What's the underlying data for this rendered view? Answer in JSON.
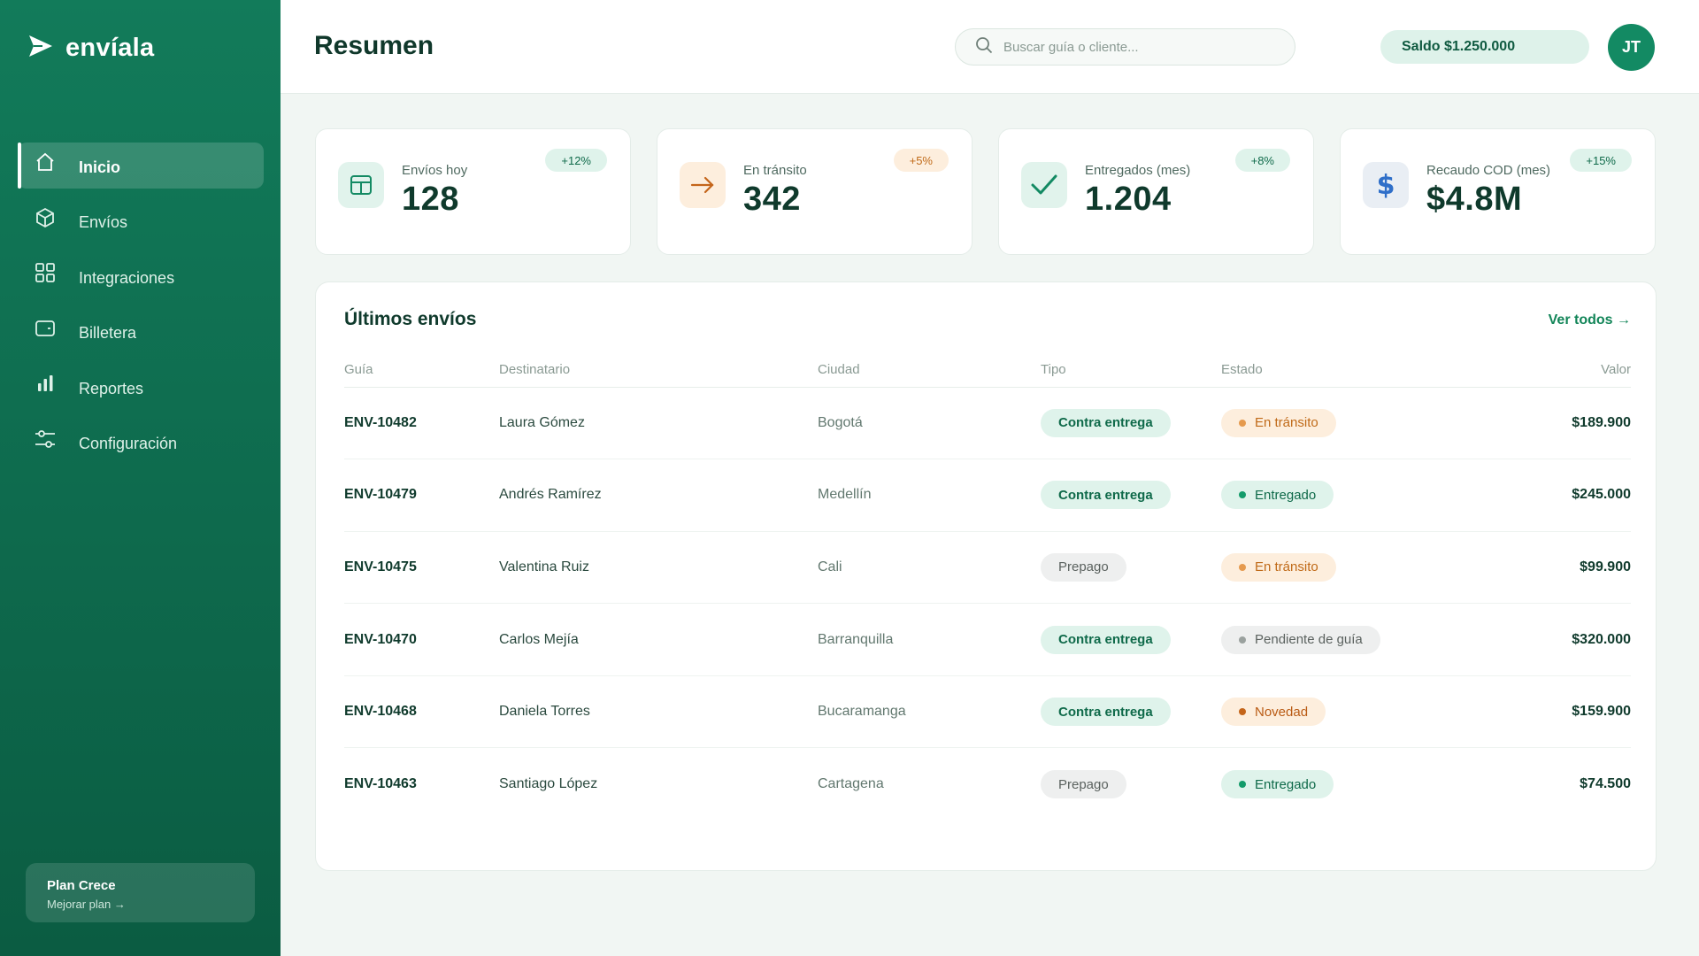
{
  "brand": {
    "name": "envíala"
  },
  "sidebar": {
    "items": [
      {
        "label": "Inicio",
        "icon": "home-icon",
        "active": true
      },
      {
        "label": "Envíos",
        "icon": "box-icon",
        "active": false
      },
      {
        "label": "Integraciones",
        "icon": "grid-icon",
        "active": false
      },
      {
        "label": "Billetera",
        "icon": "wallet-icon",
        "active": false
      },
      {
        "label": "Reportes",
        "icon": "bar-chart-icon",
        "active": false
      },
      {
        "label": "Configuración",
        "icon": "sliders-icon",
        "active": false
      }
    ],
    "plan": {
      "title": "Plan Crece",
      "link": "Mejorar plan →"
    }
  },
  "header": {
    "title": "Resumen",
    "search": {
      "placeholder": "Buscar guía o cliente...",
      "value": ""
    },
    "balance": "Saldo $1.250.000",
    "avatar": "JT"
  },
  "stats": [
    {
      "label": "Envíos hoy",
      "value": "128",
      "delta": "+12%",
      "icon": "table-icon",
      "icon_color": "#138a63",
      "icon_bg": "#e1f3ec",
      "delta_bg": "#dff3eb",
      "delta_color": "#0f6a4a"
    },
    {
      "label": "En tránsito",
      "value": "342",
      "delta": "+5%",
      "icon": "arrow-right-icon",
      "icon_color": "#c4651a",
      "icon_bg": "#fdeedd",
      "delta_bg": "#fdeedd",
      "delta_color": "#c06a18"
    },
    {
      "label": "Entregados (mes)",
      "value": "1.204",
      "delta": "+8%",
      "icon": "check-icon",
      "icon_color": "#138a63",
      "icon_bg": "#e1f3ec",
      "delta_bg": "#dff3eb",
      "delta_color": "#0f6a4a"
    },
    {
      "label": "Recaudo COD (mes)",
      "value": "$4.8M",
      "delta": "+15%",
      "icon": "dollar-icon",
      "icon_color": "#2f6fc9",
      "icon_bg": "#e9eef4",
      "delta_bg": "#dff3eb",
      "delta_color": "#0f6a4a"
    }
  ],
  "shipments": {
    "title": "Últimos envíos",
    "see_all": "Ver todos →",
    "columns": [
      "Guía",
      "Destinatario",
      "Ciudad",
      "Tipo",
      "Estado",
      "Valor"
    ],
    "rows": [
      {
        "guide": "ENV-10482",
        "recipient": "Laura Gómez",
        "city": "Bogotá",
        "type": "Contra entrega",
        "type_kind": "cod",
        "status": "En tránsito",
        "status_kind": "transit",
        "amount": "$189.900"
      },
      {
        "guide": "ENV-10479",
        "recipient": "Andrés Ramírez",
        "city": "Medellín",
        "type": "Contra entrega",
        "type_kind": "cod",
        "status": "Entregado",
        "status_kind": "delivered",
        "amount": "$245.000"
      },
      {
        "guide": "ENV-10475",
        "recipient": "Valentina Ruiz",
        "city": "Cali",
        "type": "Prepago",
        "type_kind": "pre",
        "status": "En tránsito",
        "status_kind": "transit",
        "amount": "$99.900"
      },
      {
        "guide": "ENV-10470",
        "recipient": "Carlos Mejía",
        "city": "Barranquilla",
        "type": "Contra entrega",
        "type_kind": "cod",
        "status": "Pendiente de guía",
        "status_kind": "pending",
        "amount": "$320.000"
      },
      {
        "guide": "ENV-10468",
        "recipient": "Daniela Torres",
        "city": "Bucaramanga",
        "type": "Contra entrega",
        "type_kind": "cod",
        "status": "Novedad",
        "status_kind": "novedad",
        "amount": "$159.900"
      },
      {
        "guide": "ENV-10463",
        "recipient": "Santiago López",
        "city": "Cartagena",
        "type": "Prepago",
        "type_kind": "pre",
        "status": "Entregado",
        "status_kind": "delivered",
        "amount": "$74.500"
      }
    ]
  },
  "status_colors": {
    "transit": "#e59a4e",
    "delivered": "#139b6a",
    "pending": "#9aa19e",
    "novedad": "#c4651a"
  }
}
